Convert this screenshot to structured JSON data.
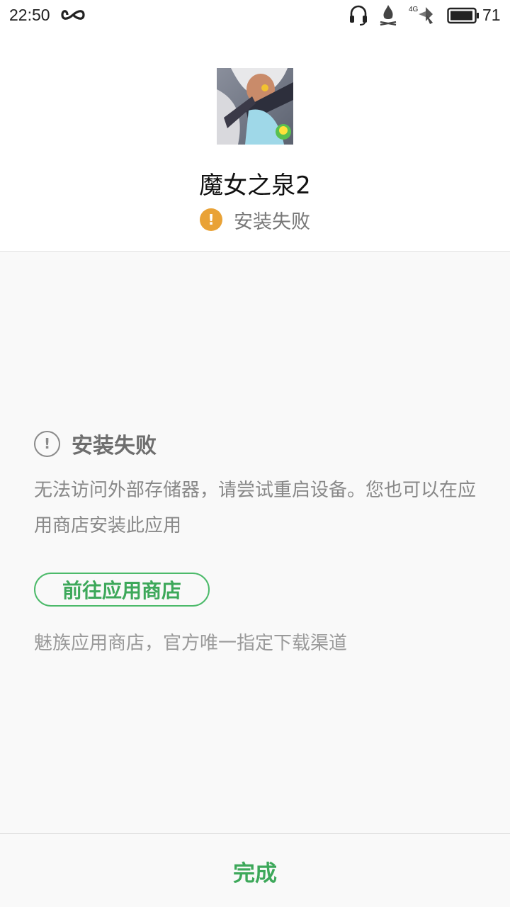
{
  "status_bar": {
    "time": "22:50",
    "network": "4G",
    "battery": "71",
    "icons": [
      "infinity-icon",
      "headset-icon",
      "flame-icon",
      "4g-signal-icon",
      "battery-icon"
    ]
  },
  "app": {
    "name": "魔女之泉2",
    "install_status": "安装失败",
    "status_color": "#e9a236"
  },
  "error": {
    "title": "安装失败",
    "description": "无法访问外部存储器，请尝试重启设备。您也可以在应用商店安装此应用",
    "store_button": "前往应用商店",
    "store_note": "魅族应用商店，官方唯一指定下载渠道"
  },
  "footer": {
    "done_label": "完成"
  },
  "colors": {
    "accent_green": "#3da85a",
    "warning_orange": "#e9a236",
    "background": "#f9f9f9"
  }
}
